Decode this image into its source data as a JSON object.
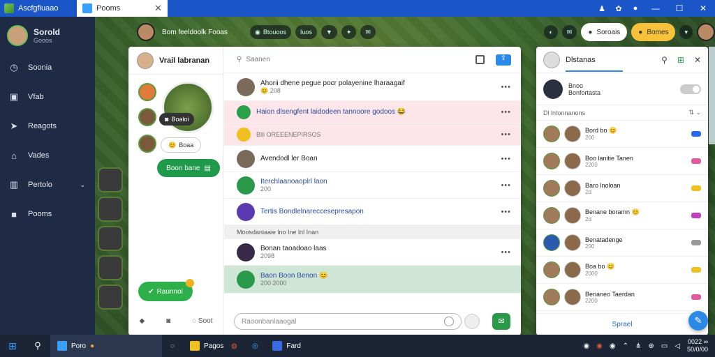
{
  "titlebar": {
    "app_name": "Ascfgfiuaao",
    "tab_label": "Pooms",
    "close_glyph": "✕",
    "right_icons": [
      "person-icon",
      "gift-icon",
      "settings-icon"
    ],
    "window_controls": [
      "—",
      "☐",
      "✕"
    ]
  },
  "sidebar": {
    "user_name": "Sorold",
    "user_sub": "Gooos",
    "items": [
      {
        "label": "Soonia",
        "icon": "clock-icon",
        "glyph": "◷"
      },
      {
        "label": "Vfab",
        "icon": "bag-icon",
        "glyph": "▣"
      },
      {
        "label": "Reagots",
        "icon": "megaphone-icon",
        "glyph": "➤"
      },
      {
        "label": "Vades",
        "icon": "home-icon",
        "glyph": "⌂"
      },
      {
        "label": "Pertolo",
        "icon": "book-icon",
        "glyph": "▥",
        "chevron": "⌄"
      },
      {
        "label": "Pooms",
        "icon": "folder-icon",
        "glyph": "■"
      }
    ]
  },
  "topbar": {
    "title": "Bom feeldoolk Fooas",
    "btn1": "Btouoos",
    "btn2": "Iuos",
    "pill_white": "Soroais",
    "pill_yellow": "Bomes"
  },
  "chat_left": {
    "title": "Vrail labranan",
    "mini_tag": "Boaloi",
    "status_pill": "Boaa",
    "green_button": "Boon bane",
    "green_button2": "Raunnoi",
    "footer_label": "Soot"
  },
  "chat_main": {
    "search_placeholder": "Saanen",
    "messages": [
      {
        "title": "Ahorii dhene pegue pocr polayenine lharaagaif",
        "sub": "😊 208",
        "style": ""
      },
      {
        "title": "Haion dlsengfent laidodeen tannoore godoos 😂",
        "sub": "",
        "style": "pink"
      },
      {
        "title": "",
        "sub": "Blli OREEENEPIRSOS",
        "style": "pink"
      },
      {
        "title": "Avendodl ler Boan",
        "sub": "",
        "style": ""
      },
      {
        "title": "Iterchlaanoaoplrl laon",
        "sub": "200",
        "style": ""
      },
      {
        "title": "Tertis Bondlelnareccesepresapon",
        "sub": "",
        "style": ""
      },
      {
        "title": "Bonan taoadoao laas",
        "sub": "2098",
        "style": ""
      },
      {
        "title": "Baon Boon Benon 😊",
        "sub": "200 2000",
        "style": "greenbg"
      }
    ],
    "section_label": "Moosdaniaaie   lno   Ine lnl Inan",
    "input_placeholder": "Raoonbanlaaogal"
  },
  "friends": {
    "title": "Dlstanas",
    "status_line1": "Bnoo",
    "status_line2": "Bonfortasta",
    "section_label": "Dl lntonnanons",
    "rows": [
      {
        "name": "Bord bo 😊",
        "sub": "200",
        "tag_color": "#2a6ae6"
      },
      {
        "name": "Boo lanitie Tanen",
        "sub": "2200",
        "tag_color": "#e05aa0"
      },
      {
        "name": "Baro lnoloan",
        "sub": "2d",
        "tag_color": "#f0c020"
      },
      {
        "name": "Benane boramn 😊",
        "sub": "2d",
        "tag_color": "#c040c0"
      },
      {
        "name": "Benatadenge",
        "sub": "200",
        "tag_color": "#999999"
      },
      {
        "name": "Boa bo 😊",
        "sub": "2000",
        "tag_color": "#f0c020"
      },
      {
        "name": "Benaneo Taerdan",
        "sub": "2200",
        "tag_color": "#e05aa0"
      }
    ],
    "footer": "Sprael"
  },
  "taskbar": {
    "active_label": "Poro",
    "app1": "Pagos",
    "app2": "Fard",
    "clock_time": "0022 ∞",
    "clock_date": "50/0/00"
  },
  "colors": {
    "accent": "#1a56c8",
    "primary_green": "#2a9a4a",
    "sidebar_bg": "#1f2a44"
  }
}
